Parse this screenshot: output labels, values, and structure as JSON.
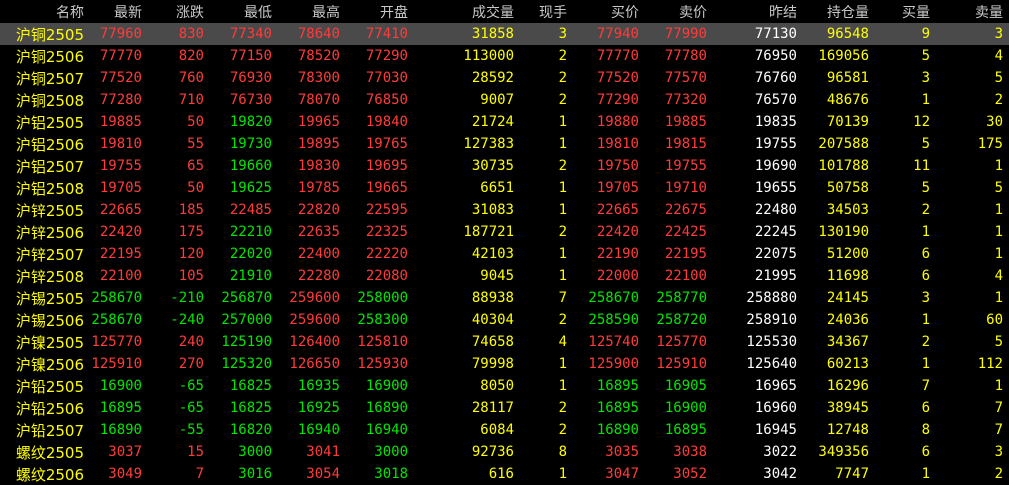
{
  "columns": [
    "名称",
    "最新",
    "涨跌",
    "最低",
    "最高",
    "开盘",
    "成交量",
    "现手",
    "买价",
    "卖价",
    "昨结",
    "持仓量",
    "买量",
    "卖量"
  ],
  "rows": [
    {
      "name": "沪铜2505",
      "last": "77960",
      "chg": "830",
      "low": "77340",
      "high": "78640",
      "open": "77410",
      "vol": "31858",
      "cur": "3",
      "bid": "77940",
      "ask": "77990",
      "prev": "77130",
      "oi": "96548",
      "bidv": "9",
      "askv": "3"
    },
    {
      "name": "沪铜2506",
      "last": "77770",
      "chg": "820",
      "low": "77150",
      "high": "78520",
      "open": "77290",
      "vol": "113000",
      "cur": "2",
      "bid": "77770",
      "ask": "77780",
      "prev": "76950",
      "oi": "169056",
      "bidv": "5",
      "askv": "4"
    },
    {
      "name": "沪铜2507",
      "last": "77520",
      "chg": "760",
      "low": "76930",
      "high": "78300",
      "open": "77030",
      "vol": "28592",
      "cur": "2",
      "bid": "77520",
      "ask": "77570",
      "prev": "76760",
      "oi": "96581",
      "bidv": "3",
      "askv": "5"
    },
    {
      "name": "沪铜2508",
      "last": "77280",
      "chg": "710",
      "low": "76730",
      "high": "78070",
      "open": "76850",
      "vol": "9007",
      "cur": "2",
      "bid": "77290",
      "ask": "77320",
      "prev": "76570",
      "oi": "48676",
      "bidv": "1",
      "askv": "2"
    },
    {
      "name": "沪铝2505",
      "last": "19885",
      "chg": "50",
      "low": "19820",
      "high": "19965",
      "open": "19840",
      "vol": "21724",
      "cur": "1",
      "bid": "19880",
      "ask": "19885",
      "prev": "19835",
      "oi": "70139",
      "bidv": "12",
      "askv": "30"
    },
    {
      "name": "沪铝2506",
      "last": "19810",
      "chg": "55",
      "low": "19730",
      "high": "19895",
      "open": "19765",
      "vol": "127383",
      "cur": "1",
      "bid": "19810",
      "ask": "19815",
      "prev": "19755",
      "oi": "207588",
      "bidv": "5",
      "askv": "175"
    },
    {
      "name": "沪铝2507",
      "last": "19755",
      "chg": "65",
      "low": "19660",
      "high": "19830",
      "open": "19695",
      "vol": "30735",
      "cur": "2",
      "bid": "19750",
      "ask": "19755",
      "prev": "19690",
      "oi": "101788",
      "bidv": "11",
      "askv": "1"
    },
    {
      "name": "沪铝2508",
      "last": "19705",
      "chg": "50",
      "low": "19625",
      "high": "19785",
      "open": "19665",
      "vol": "6651",
      "cur": "1",
      "bid": "19705",
      "ask": "19710",
      "prev": "19655",
      "oi": "50758",
      "bidv": "5",
      "askv": "5"
    },
    {
      "name": "沪锌2505",
      "last": "22665",
      "chg": "185",
      "low": "22485",
      "high": "22820",
      "open": "22595",
      "vol": "31083",
      "cur": "1",
      "bid": "22665",
      "ask": "22675",
      "prev": "22480",
      "oi": "34503",
      "bidv": "2",
      "askv": "1"
    },
    {
      "name": "沪锌2506",
      "last": "22420",
      "chg": "175",
      "low": "22210",
      "high": "22635",
      "open": "22325",
      "vol": "187721",
      "cur": "2",
      "bid": "22420",
      "ask": "22425",
      "prev": "22245",
      "oi": "130190",
      "bidv": "1",
      "askv": "1"
    },
    {
      "name": "沪锌2507",
      "last": "22195",
      "chg": "120",
      "low": "22020",
      "high": "22400",
      "open": "22220",
      "vol": "42103",
      "cur": "1",
      "bid": "22190",
      "ask": "22195",
      "prev": "22075",
      "oi": "51200",
      "bidv": "6",
      "askv": "1"
    },
    {
      "name": "沪锌2508",
      "last": "22100",
      "chg": "105",
      "low": "21910",
      "high": "22280",
      "open": "22080",
      "vol": "9045",
      "cur": "1",
      "bid": "22000",
      "ask": "22100",
      "prev": "21995",
      "oi": "11698",
      "bidv": "6",
      "askv": "4"
    },
    {
      "name": "沪锡2505",
      "last": "258670",
      "chg": "-210",
      "low": "256870",
      "high": "259600",
      "open": "258000",
      "vol": "88938",
      "cur": "7",
      "bid": "258670",
      "ask": "258770",
      "prev": "258880",
      "oi": "24145",
      "bidv": "3",
      "askv": "1"
    },
    {
      "name": "沪锡2506",
      "last": "258670",
      "chg": "-240",
      "low": "257000",
      "high": "259600",
      "open": "258300",
      "vol": "40304",
      "cur": "2",
      "bid": "258590",
      "ask": "258720",
      "prev": "258910",
      "oi": "24036",
      "bidv": "1",
      "askv": "60"
    },
    {
      "name": "沪镍2505",
      "last": "125770",
      "chg": "240",
      "low": "125190",
      "high": "126400",
      "open": "125810",
      "vol": "74658",
      "cur": "4",
      "bid": "125740",
      "ask": "125770",
      "prev": "125530",
      "oi": "34367",
      "bidv": "2",
      "askv": "5"
    },
    {
      "name": "沪镍2506",
      "last": "125910",
      "chg": "270",
      "low": "125320",
      "high": "126650",
      "open": "125930",
      "vol": "79998",
      "cur": "1",
      "bid": "125900",
      "ask": "125910",
      "prev": "125640",
      "oi": "60213",
      "bidv": "1",
      "askv": "112"
    },
    {
      "name": "沪铅2505",
      "last": "16900",
      "chg": "-65",
      "low": "16825",
      "high": "16935",
      "open": "16900",
      "vol": "8050",
      "cur": "1",
      "bid": "16895",
      "ask": "16905",
      "prev": "16965",
      "oi": "16296",
      "bidv": "7",
      "askv": "1"
    },
    {
      "name": "沪铅2506",
      "last": "16895",
      "chg": "-65",
      "low": "16825",
      "high": "16925",
      "open": "16890",
      "vol": "28117",
      "cur": "2",
      "bid": "16895",
      "ask": "16900",
      "prev": "16960",
      "oi": "38945",
      "bidv": "6",
      "askv": "7"
    },
    {
      "name": "沪铅2507",
      "last": "16890",
      "chg": "-55",
      "low": "16820",
      "high": "16940",
      "open": "16940",
      "vol": "6084",
      "cur": "2",
      "bid": "16890",
      "ask": "16895",
      "prev": "16945",
      "oi": "12748",
      "bidv": "8",
      "askv": "7"
    },
    {
      "name": "螺纹2505",
      "last": "3037",
      "chg": "15",
      "low": "3000",
      "high": "3041",
      "open": "3000",
      "vol": "92736",
      "cur": "8",
      "bid": "3035",
      "ask": "3038",
      "prev": "3022",
      "oi": "349356",
      "bidv": "6",
      "askv": "3"
    },
    {
      "name": "螺纹2506",
      "last": "3049",
      "chg": "7",
      "low": "3016",
      "high": "3054",
      "open": "3018",
      "vol": "616",
      "cur": "1",
      "bid": "3047",
      "ask": "3052",
      "prev": "3042",
      "oi": "7747",
      "bidv": "1",
      "askv": "2"
    }
  ],
  "selected_row": 0,
  "colors": {
    "up": "#ff3b3b",
    "down": "#00e600",
    "flat": "#ffffff",
    "name": "#ffff00",
    "volume": "#ffff00",
    "header": "#c8c8c8",
    "background": "#000000",
    "selected_row": "#4a4a4a"
  }
}
